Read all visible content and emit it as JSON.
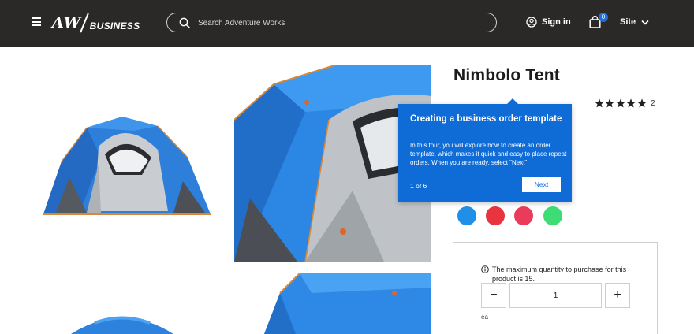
{
  "header": {
    "logo": {
      "mark": "AW",
      "text": "BUSINESS"
    },
    "search": {
      "placeholder": "Search Adventure Works"
    },
    "sign_in_label": "Sign in",
    "cart_count": "0",
    "site_label": "Site",
    "icons": {
      "menu": "hamburger-icon",
      "search": "search-icon",
      "account": "user-circle-icon",
      "cart": "shopping-bag-icon",
      "site": "chevron-down-icon"
    }
  },
  "gallery": {
    "images": [
      {
        "name": "tent-image-front"
      },
      {
        "name": "tent-image-closeup"
      },
      {
        "name": "tent-image-top"
      },
      {
        "name": "tent-image-partial"
      }
    ]
  },
  "product": {
    "title": "Nimbolo Tent",
    "rating": {
      "stars": 5,
      "count": "2"
    },
    "colors": [
      "#1f8fe8",
      "#e8343f",
      "#ea3b5a",
      "#3ddc74"
    ]
  },
  "tour": {
    "title": "Creating a business order template",
    "body": "In this tour, you will explore how to create an order template, which makes it quick and easy to place repeat orders. When you are ready, select \"Next\".",
    "step": "1 of 6",
    "next_label": "Next",
    "color": "#0f6cd6"
  },
  "purchase": {
    "max_notice": "The maximum quantity to purchase for this product is 15.",
    "quantity": "1",
    "decrement_label": "−",
    "increment_label": "+",
    "unit": "ea"
  }
}
